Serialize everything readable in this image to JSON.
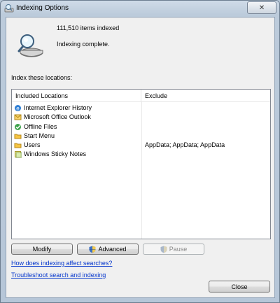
{
  "window": {
    "title": "Indexing Options",
    "close_label": "✕"
  },
  "status": {
    "items_indexed": "111,510 items indexed",
    "state": "Indexing complete."
  },
  "locations": {
    "label": "Index these locations:",
    "columns": {
      "included": "Included Locations",
      "exclude": "Exclude"
    },
    "rows": [
      {
        "name": "Internet Explorer History",
        "exclude": "",
        "icon": "internet-explorer-icon"
      },
      {
        "name": "Microsoft Office Outlook",
        "exclude": "",
        "icon": "outlook-icon"
      },
      {
        "name": "Offline Files",
        "exclude": "",
        "icon": "offline-files-icon"
      },
      {
        "name": "Start Menu",
        "exclude": "",
        "icon": "folder-icon"
      },
      {
        "name": "Users",
        "exclude": "AppData; AppData; AppData",
        "icon": "folder-icon"
      },
      {
        "name": "Windows Sticky Notes",
        "exclude": "",
        "icon": "sticky-notes-icon"
      }
    ]
  },
  "buttons": {
    "modify": "Modify",
    "advanced": "Advanced",
    "pause": "Pause",
    "close": "Close"
  },
  "links": {
    "how_indexing": "How does indexing affect searches?",
    "troubleshoot": "Troubleshoot search and indexing"
  }
}
